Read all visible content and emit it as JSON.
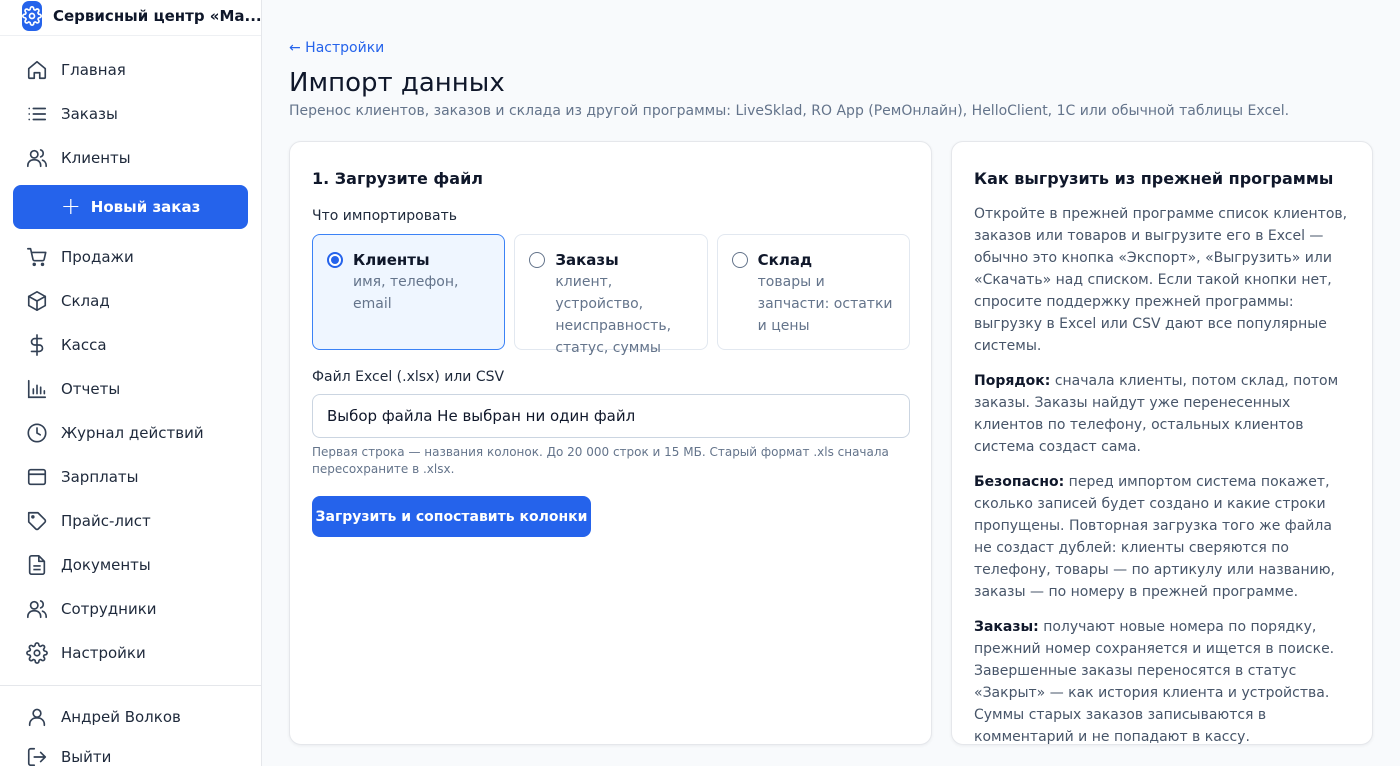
{
  "brand": {
    "name": "Сервисный центр «Ма..."
  },
  "sidebar": {
    "items": [
      {
        "label": "Главная",
        "icon": "home-icon"
      },
      {
        "label": "Заказы",
        "icon": "list-icon"
      },
      {
        "label": "Клиенты",
        "icon": "users-icon"
      }
    ],
    "new_order_label": "Новый заказ",
    "items2": [
      {
        "label": "Продажи",
        "icon": "cart-icon"
      },
      {
        "label": "Склад",
        "icon": "box-icon"
      },
      {
        "label": "Касса",
        "icon": "dollar-icon"
      },
      {
        "label": "Отчеты",
        "icon": "bar-chart-icon"
      },
      {
        "label": "Журнал действий",
        "icon": "clock-icon"
      },
      {
        "label": "Зарплаты",
        "icon": "wallet-icon"
      },
      {
        "label": "Прайс-лист",
        "icon": "tag-icon"
      },
      {
        "label": "Документы",
        "icon": "document-icon"
      },
      {
        "label": "Сотрудники",
        "icon": "users-icon"
      },
      {
        "label": "Настройки",
        "icon": "gear-icon"
      }
    ],
    "user_name": "Андрей Волков",
    "logout_label": "Выйти"
  },
  "page": {
    "back_link": "← Настройки",
    "title": "Импорт данных",
    "subtitle": "Перенос клиентов, заказов и склада из другой программы: LiveSklad, RO App (РемОнлайн), HelloClient, 1С или обычной таблицы Excel."
  },
  "upload": {
    "step_title": "1. Загрузите файл",
    "what_label": "Что импортировать",
    "options": [
      {
        "title": "Клиенты",
        "desc": "имя, телефон, email",
        "selected": true
      },
      {
        "title": "Заказы",
        "desc": "клиент, устройство, неисправность, статус, суммы",
        "selected": false
      },
      {
        "title": "Склад",
        "desc": "товары и запчасти: остатки и цены",
        "selected": false
      }
    ],
    "file_label": "Файл Excel (.xlsx) или CSV",
    "file_value": "Выбор файла Не выбран ни один файл",
    "hint": "Первая строка — названия колонок. До 20 000 строк и 15 МБ. Старый формат .xls сначала пересохраните в .xlsx.",
    "button_label": "Загрузить и сопоставить колонки"
  },
  "help": {
    "title": "Как выгрузить из прежней программы",
    "intro": "Откройте в прежней программе список клиентов, заказов или товаров и выгрузите его в Excel — обычно это кнопка «Экспорт», «Выгрузить» или «Скачать» над списком. Если такой кнопки нет, спросите поддержку прежней программы: выгрузку в Excel или CSV дают все популярные системы.",
    "order_label": "Порядок:",
    "order_text": " сначала клиенты, потом склад, потом заказы. Заказы найдут уже перенесенных клиентов по телефону, остальных клиентов система создаст сама.",
    "safe_label": "Безопасно:",
    "safe_text": " перед импортом система покажет, сколько записей будет создано и какие строки пропущены. Повторная загрузка того же файла не создаст дублей: клиенты сверяются по телефону, товары — по артикулу или названию, заказы — по номеру в прежней программе.",
    "orders_label": "Заказы:",
    "orders_text": " получают новые номера по порядку, прежний номер сохраняется и ищется в поиске. Завершенные заказы переносятся в статус «Закрыт» — как история клиента и устройства. Суммы старых заказов записываются в комментарий и не попадают в кассу."
  },
  "colors": {
    "accent": "#2563eb",
    "selected_bg": "#eff6ff",
    "muted": "#64748b"
  }
}
